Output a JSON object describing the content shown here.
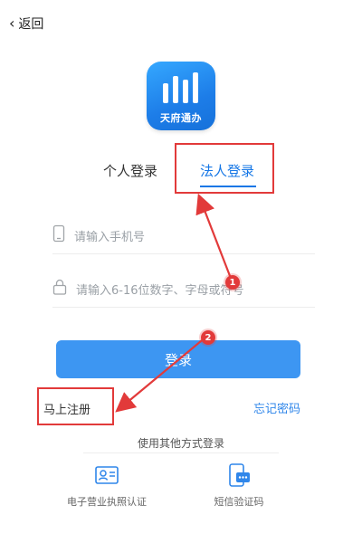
{
  "header": {
    "back_label": "返回"
  },
  "app": {
    "name": "天府通办"
  },
  "tabs": [
    {
      "label": "个人登录",
      "active": false
    },
    {
      "label": "法人登录",
      "active": true
    }
  ],
  "form": {
    "phone_placeholder": "请输入手机号",
    "password_placeholder": "请输入6-16位数字、字母或符号"
  },
  "buttons": {
    "login_label": "登录",
    "register_label": "马上注册",
    "forgot_label": "忘记密码"
  },
  "other_login": {
    "title": "使用其他方式登录",
    "options": [
      {
        "label": "电子营业执照认证",
        "icon": "license-card-icon"
      },
      {
        "label": "短信验证码",
        "icon": "sms-icon"
      }
    ]
  },
  "annotations": {
    "markers": [
      "1",
      "2"
    ]
  },
  "colors": {
    "accent": "#1677e6",
    "button": "#3d96f2",
    "annotation": "#e23a3a"
  }
}
